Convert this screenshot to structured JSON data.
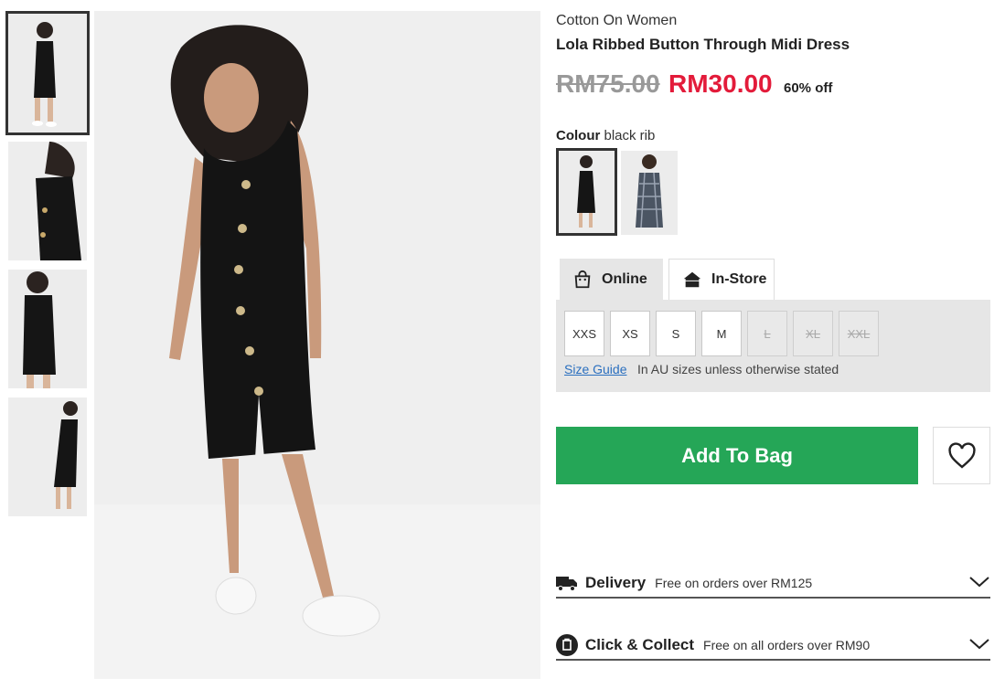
{
  "product": {
    "brand": "Cotton On Women",
    "title": "Lola Ribbed Button Through Midi Dress",
    "old_price": "RM75.00",
    "new_price": "RM30.00",
    "discount": "60% off"
  },
  "colour": {
    "label": "Colour",
    "value": "black rib",
    "swatches": [
      "black rib",
      "check"
    ]
  },
  "tabs": {
    "online": "Online",
    "store": "In-Store"
  },
  "sizes": [
    {
      "label": "XXS",
      "available": true
    },
    {
      "label": "XS",
      "available": true
    },
    {
      "label": "S",
      "available": true
    },
    {
      "label": "M",
      "available": true
    },
    {
      "label": "L",
      "available": false
    },
    {
      "label": "XL",
      "available": false
    },
    {
      "label": "XXL",
      "available": false
    }
  ],
  "size_guide": "Size Guide",
  "size_note": "In AU sizes unless otherwise stated",
  "actions": {
    "add_to_bag": "Add To Bag"
  },
  "delivery": {
    "delivery_label": "Delivery",
    "delivery_sub": "Free on orders over RM125",
    "collect_label": "Click & Collect",
    "collect_sub": "Free on all orders over RM90"
  },
  "colors": {
    "sale": "#e31b3a",
    "cta": "#25a657",
    "link": "#2a6fbf"
  }
}
